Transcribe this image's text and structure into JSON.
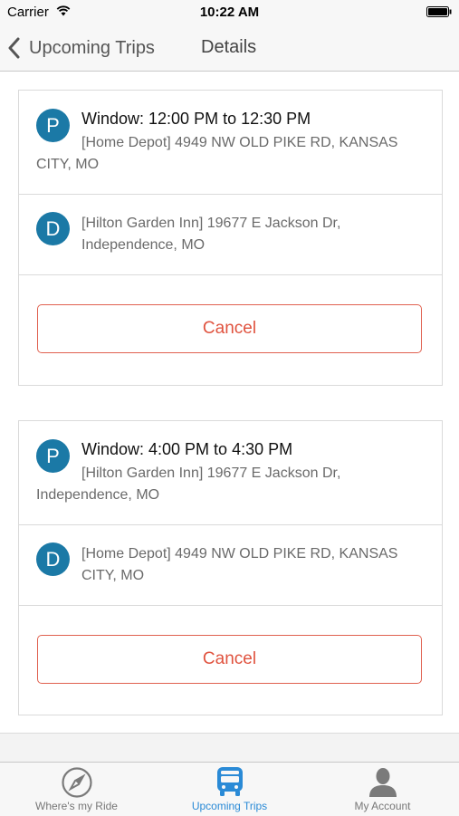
{
  "status_bar": {
    "carrier": "Carrier",
    "time": "10:22 AM"
  },
  "nav": {
    "back_label": "Upcoming Trips",
    "title": "Details"
  },
  "trips": [
    {
      "pickup": {
        "badge": "P",
        "window": "Window: 12:00 PM to 12:30 PM",
        "address_line1": "[Home Depot] 4949 NW OLD PIKE RD, KANSAS",
        "address_line2": "CITY, MO"
      },
      "dropoff": {
        "badge": "D",
        "address_line1": "[Hilton Garden Inn] 19677 E Jackson Dr,",
        "address_line2": "Independence, MO"
      },
      "cancel_label": "Cancel"
    },
    {
      "pickup": {
        "badge": "P",
        "window": "Window: 4:00 PM to 4:30 PM",
        "address_line1": "[Hilton Garden Inn] 19677 E Jackson Dr,",
        "address_line2": "Independence, MO"
      },
      "dropoff": {
        "badge": "D",
        "address_line1": "[Home Depot] 4949 NW OLD PIKE RD, KANSAS",
        "address_line2": "CITY, MO"
      },
      "cancel_label": "Cancel"
    }
  ],
  "tab_bar": {
    "tabs": [
      {
        "label": "Where's my Ride",
        "icon": "compass-icon"
      },
      {
        "label": "Upcoming Trips",
        "icon": "bus-icon"
      },
      {
        "label": "My Account",
        "icon": "person-icon"
      }
    ],
    "active_index": 1
  },
  "colors": {
    "badge": "#1b79a6",
    "cancel": "#e0533f",
    "active_tab": "#2a8ad6"
  }
}
